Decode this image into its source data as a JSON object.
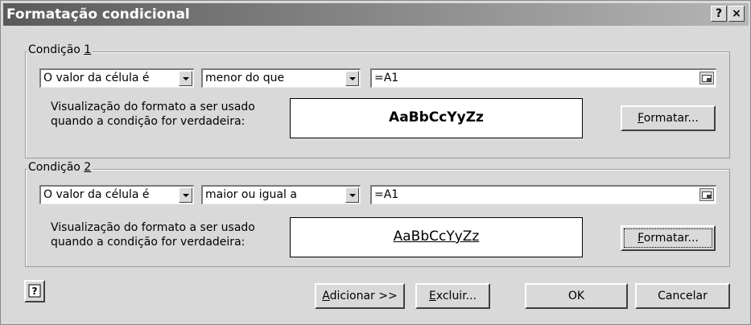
{
  "title": "Formatação condicional",
  "titlebar_buttons": {
    "help": "?",
    "close": "×"
  },
  "condition1": {
    "legend_prefix": "Condição ",
    "legend_key": "1",
    "type_value": "O valor da célula é",
    "operator_value": "menor do que",
    "formula_value": "=A1",
    "preview_label_line1": "Visualização do formato a ser usado",
    "preview_label_line2": "quando a condição for verdadeira:",
    "preview_text": "AaBbCcYyZz",
    "format_key": "F",
    "format_rest": "ormatar..."
  },
  "condition2": {
    "legend_prefix": "Condição ",
    "legend_key": "2",
    "type_value": "O valor da célula é",
    "operator_value": "maior ou igual a",
    "formula_value": "=A1",
    "preview_label_line1": "Visualização do formato a ser usado",
    "preview_label_line2": "quando a condição for verdadeira:",
    "preview_text": "AaBbCcYyZz",
    "format_key": "F",
    "format_rest": "ormatar..."
  },
  "footer": {
    "help_icon": "help-question-icon",
    "add_key": "A",
    "add_rest": "dicionar >>",
    "delete_key": "E",
    "delete_rest": "xcluir...",
    "ok_label": "OK",
    "cancel_label": "Cancelar"
  }
}
